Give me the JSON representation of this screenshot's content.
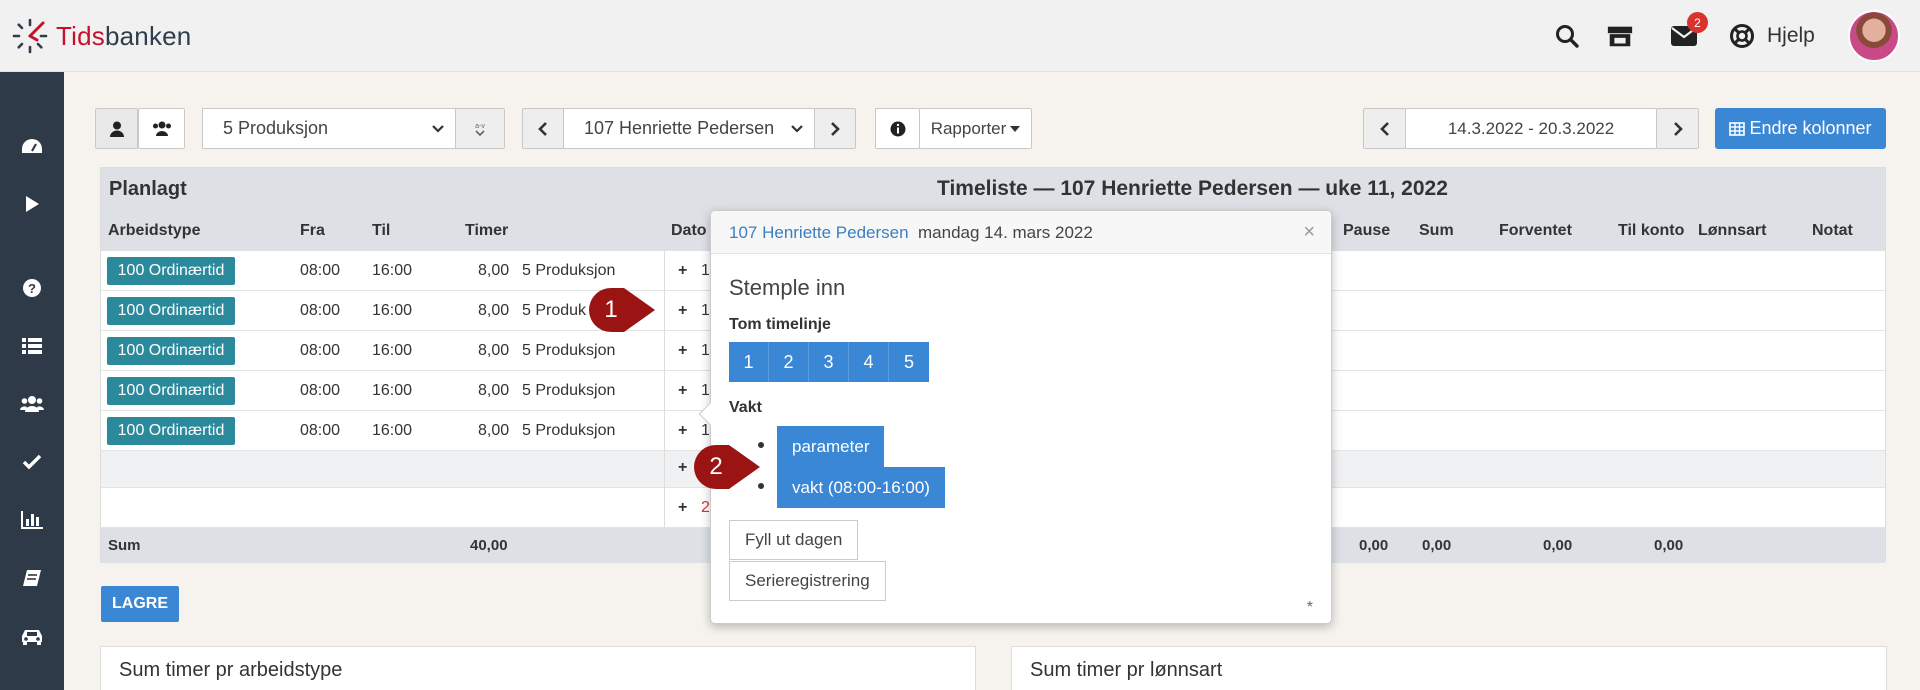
{
  "app": {
    "logo_prefix": "Tids",
    "logo_suffix": "banken",
    "brand_color": "#c8102e"
  },
  "topnav": {
    "help_label": "Hjelp",
    "messages_badge": "2"
  },
  "toolbar": {
    "department_select": "5 Produksjon",
    "employee_select": "107 Henriette Pedersen",
    "reports_label": "Rapporter",
    "date_range": "14.3.2022 - 20.3.2022",
    "change_columns_label": "Endre kolonner"
  },
  "timesheet": {
    "planned_title": "Planlagt",
    "title": "Timeliste — 107 Henriette Pedersen — uke 11, 2022",
    "columns": {
      "arbeidstype": "Arbeidstype",
      "fra": "Fra",
      "til": "Til",
      "timer": "Timer",
      "dato": "Dato",
      "pause": "Pause",
      "sum": "Sum",
      "forventet": "Forventet",
      "til_konto": "Til konto",
      "lonnsart": "Lønnsart",
      "notat": "Notat"
    },
    "rows": [
      {
        "type": "100 Ordinærtid",
        "from": "08:00",
        "to": "16:00",
        "hours": "8,00",
        "dept": "5 Produksjon",
        "date": "1"
      },
      {
        "type": "100 Ordinærtid",
        "from": "08:00",
        "to": "16:00",
        "hours": "8,00",
        "dept": "5 Produk",
        "date": "1"
      },
      {
        "type": "100 Ordinærtid",
        "from": "08:00",
        "to": "16:00",
        "hours": "8,00",
        "dept": "5 Produksjon",
        "date": "1"
      },
      {
        "type": "100 Ordinærtid",
        "from": "08:00",
        "to": "16:00",
        "hours": "8,00",
        "dept": "5 Produksjon",
        "date": "1"
      },
      {
        "type": "100 Ordinærtid",
        "from": "08:00",
        "to": "16:00",
        "hours": "8,00",
        "dept": "5 Produksjon",
        "date": "1"
      }
    ],
    "extra_row_date": "2",
    "sum": {
      "label": "Sum",
      "timer": "40,00",
      "pause": "0,00",
      "sum": "0,00",
      "forventet": "0,00",
      "til_konto": "0,00"
    },
    "save_label": "LAGRE"
  },
  "cards": {
    "arbeidstype_title": "Sum timer pr arbeidstype",
    "lonnsart_title": "Sum timer pr lønnsart"
  },
  "popover": {
    "employee": "107 Henriette Pedersen",
    "date": "mandag 14. mars 2022",
    "close": "×",
    "heading": "Stemple inn",
    "empty_label": "Tom timelinje",
    "empty_buttons": [
      "1",
      "2",
      "3",
      "4",
      "5"
    ],
    "shift_label": "Vakt",
    "shifts": [
      "parameter",
      "vakt (08:00-16:00)"
    ],
    "fill_day_label": "Fyll ut dagen",
    "series_label": "Serieregistrering",
    "footnote": "*"
  },
  "markers": [
    "1",
    "2"
  ]
}
